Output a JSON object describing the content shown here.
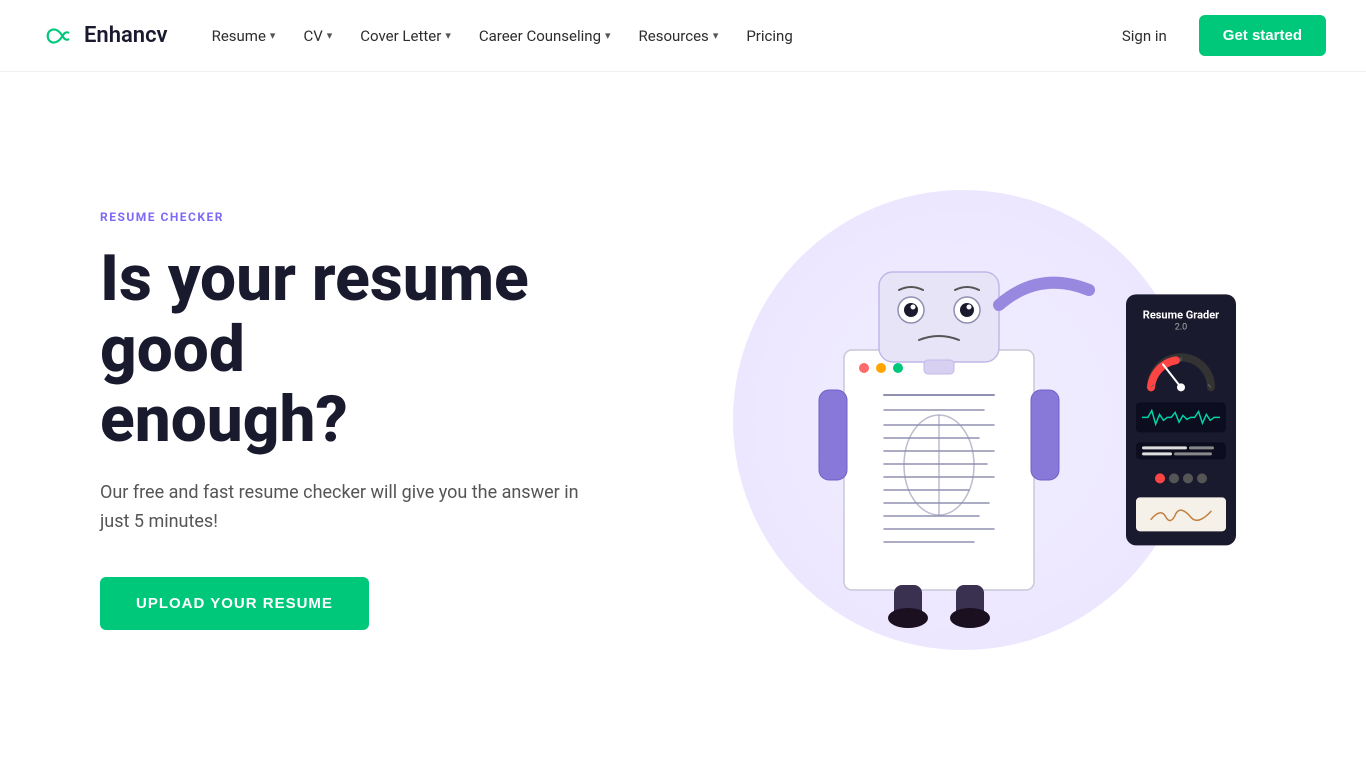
{
  "logo": {
    "text": "Enhancv"
  },
  "nav": {
    "links": [
      {
        "label": "Resume",
        "hasDropdown": true
      },
      {
        "label": "CV",
        "hasDropdown": true
      },
      {
        "label": "Cover Letter",
        "hasDropdown": true
      },
      {
        "label": "Career Counseling",
        "hasDropdown": true
      },
      {
        "label": "Resources",
        "hasDropdown": true
      },
      {
        "label": "Pricing",
        "hasDropdown": false
      }
    ],
    "sign_in": "Sign in",
    "get_started": "Get started"
  },
  "hero": {
    "section_label": "RESUME CHECKER",
    "title_line1": "Is your resume good",
    "title_line2": "enough?",
    "subtitle": "Our free and fast resume checker will give you the answer in just 5 minutes!",
    "cta_button": "UPLOAD YOUR RESUME"
  },
  "grader": {
    "title": "Resume Grader",
    "version": "2.0"
  },
  "colors": {
    "teal": "#00c87a",
    "purple_light": "#7c6af7",
    "dark_navy": "#1a1a2e"
  }
}
